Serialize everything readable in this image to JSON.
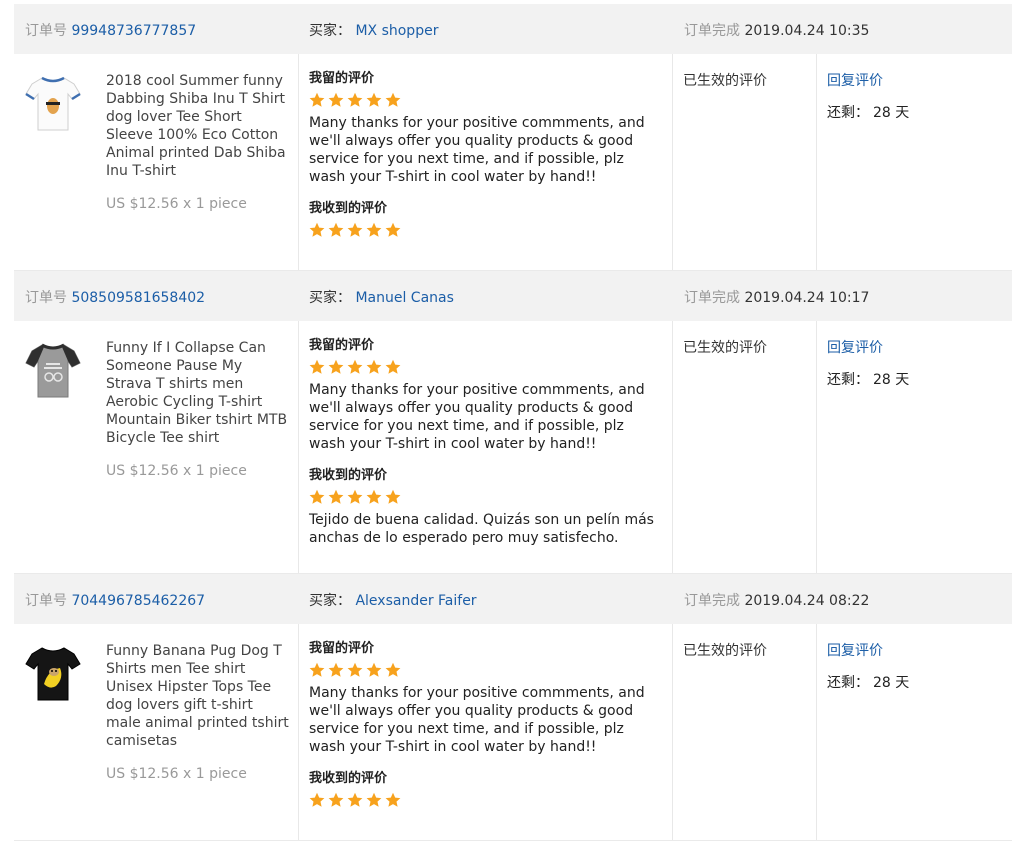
{
  "labels": {
    "order_no": "订单号",
    "buyer": "买家：",
    "completed": "订单完成",
    "my_review": "我留的评价",
    "received_review": "我收到的评价",
    "status": "已生效的评价",
    "reply": "回复评价",
    "remaining": "还剩："
  },
  "colors": {
    "star": "#f7a21d",
    "link": "#1c5ea7",
    "header_bg": "#f2f2f2"
  },
  "rating_scale": 5,
  "orders": [
    {
      "order_number": "99948736777857",
      "buyer": "MX shopper",
      "completed_time": "2019.04.24 10:35",
      "product": {
        "image_icon": "white-tshirt-dog-print",
        "title": "2018 cool Summer funny Dabbing Shiba Inu T Shirt dog lover Tee Short Sleeve 100% Eco Cotton Animal printed Dab Shiba Inu T-shirt",
        "price": "US $12.56 x 1 piece"
      },
      "my_rating": 5,
      "my_review_text": "Many thanks for your positive commments, and we'll always offer you quality products & good service for you next time, and if possible, plz wash your T-shirt in cool water by hand!!",
      "received_rating": 5,
      "received_review_text": "",
      "remaining": "28 天"
    },
    {
      "order_number": "508509581658402",
      "buyer": "Manuel Canas",
      "completed_time": "2019.04.24 10:17",
      "product": {
        "image_icon": "grey-raglan-tshirt",
        "title": "Funny If I Collapse Can Someone Pause My Strava T shirts men Aerobic Cycling T-shirt Mountain Biker tshirt MTB Bicycle Tee shirt",
        "price": "US $12.56 x 1 piece"
      },
      "my_rating": 5,
      "my_review_text": "Many thanks for your positive commments, and we'll always offer you quality products & good service for you next time, and if possible, plz wash your T-shirt in cool water by hand!!",
      "received_rating": 5,
      "received_review_text": "Tejido de buena calidad. Quizás son un pelín más anchas de lo esperado pero muy satisfecho.",
      "remaining": "28 天"
    },
    {
      "order_number": "704496785462267",
      "buyer": "Alexsander Faifer",
      "completed_time": "2019.04.24 08:22",
      "product": {
        "image_icon": "black-tshirt-banana-pug",
        "title": "Funny Banana Pug Dog T Shirts men Tee shirt Unisex Hipster Tops Tee dog lovers gift t-shirt male animal printed tshirt camisetas",
        "price": "US $12.56 x 1 piece"
      },
      "my_rating": 5,
      "my_review_text": "Many thanks for your positive commments, and we'll always offer you quality products & good service for you next time, and if possible, plz wash your T-shirt in cool water by hand!!",
      "received_rating": 5,
      "received_review_text": "",
      "remaining": "28 天"
    }
  ]
}
